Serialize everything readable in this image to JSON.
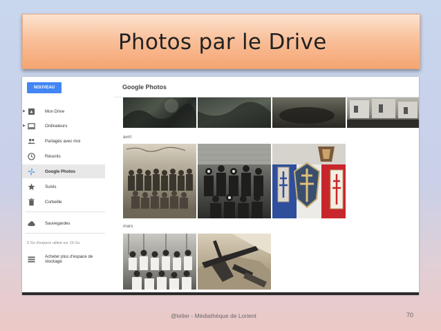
{
  "slide": {
    "title": "Photos par le Drive",
    "footer": "@telier - Médiathèque de Lorient",
    "page_number": "70"
  },
  "app": {
    "new_button": "NOUVEAU",
    "title": "Google Photos"
  },
  "sidebar": {
    "items": [
      {
        "label": "Mon Drive",
        "icon": "drive-icon",
        "expandable": true
      },
      {
        "label": "Ordinateurs",
        "icon": "computer-icon",
        "expandable": true
      },
      {
        "label": "Partagés avec moi",
        "icon": "shared-people-icon"
      },
      {
        "label": "Récents",
        "icon": "clock-icon"
      },
      {
        "label": "Google Photos",
        "icon": "pinwheel-icon",
        "active": true
      },
      {
        "label": "Suivis",
        "icon": "star-icon"
      },
      {
        "label": "Corbeille",
        "icon": "trash-icon"
      },
      {
        "label": "Sauvegardes",
        "icon": "cloud-icon"
      }
    ],
    "storage": "5 Go d'espace utilisé sur 19 Go",
    "buy_storage": "Acheter plus d'espace de stockage"
  },
  "months": [
    "avril",
    "mars"
  ],
  "colors": {
    "accent": "#4285f4",
    "title_gradient_top": "#fde3d0",
    "title_gradient_bottom": "#f6a471"
  }
}
